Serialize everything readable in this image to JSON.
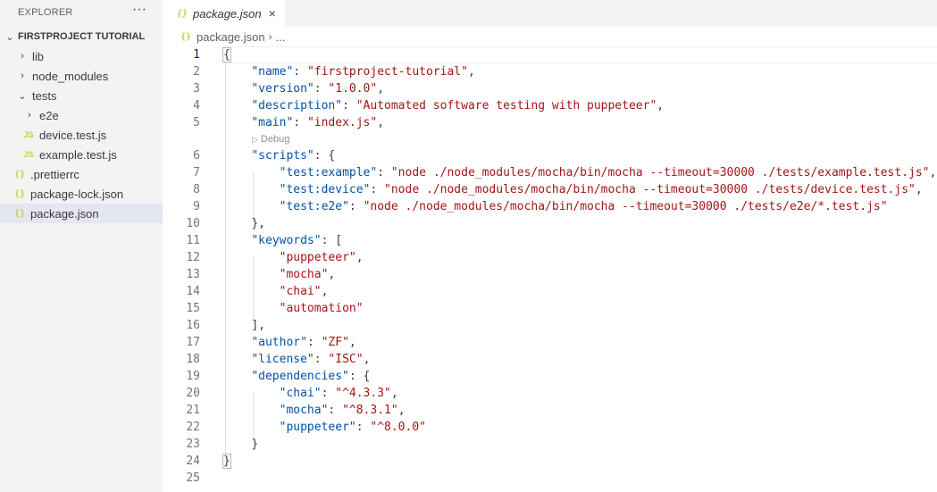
{
  "sidebar": {
    "title": "EXPLORER",
    "more": "···",
    "project": "FIRSTPROJECT TUTORIAL",
    "items": [
      {
        "label": "lib",
        "chev": "›"
      },
      {
        "label": "node_modules",
        "chev": "›"
      },
      {
        "label": "tests",
        "chev": "⌄"
      },
      {
        "label": "e2e",
        "chev": "›"
      },
      {
        "label": "device.test.js",
        "icon": "JS"
      },
      {
        "label": "example.test.js",
        "icon": "JS"
      },
      {
        "label": ".prettierrc",
        "icon": "{}"
      },
      {
        "label": "package-lock.json",
        "icon": "{}"
      },
      {
        "label": "package.json",
        "icon": "{}"
      }
    ]
  },
  "tab": {
    "icon": "{}",
    "label": "package.json",
    "close": "×"
  },
  "breadcrumb": {
    "icon": "{}",
    "file": "package.json",
    "sep": "›",
    "more": "..."
  },
  "codelens": {
    "icon": "▷",
    "label": "Debug"
  },
  "code": {
    "line_numbers": [
      "1",
      "2",
      "3",
      "4",
      "5",
      "6",
      "7",
      "8",
      "9",
      "10",
      "11",
      "12",
      "13",
      "14",
      "15",
      "16",
      "17",
      "18",
      "19",
      "20",
      "21",
      "22",
      "23",
      "24",
      "25"
    ],
    "l1": "{",
    "l2": {
      "key": "\"name\"",
      "val": "\"firstproject-tutorial\"",
      "tail": ","
    },
    "l3": {
      "key": "\"version\"",
      "val": "\"1.0.0\"",
      "tail": ","
    },
    "l4": {
      "key": "\"description\"",
      "val": "\"Automated software testing with puppeteer\"",
      "tail": ","
    },
    "l5": {
      "key": "\"main\"",
      "val": "\"index.js\"",
      "tail": ","
    },
    "l6": {
      "key": "\"scripts\"",
      "tail": ": {"
    },
    "l7": {
      "key": "\"test:example\"",
      "val": "\"node ./node_modules/mocha/bin/mocha --timeout=30000 ./tests/example.test.js\"",
      "tail": ","
    },
    "l8": {
      "key": "\"test:device\"",
      "val": "\"node ./node_modules/mocha/bin/mocha --timeout=30000 ./tests/device.test.js\"",
      "tail": ","
    },
    "l9": {
      "key": "\"test:e2e\"",
      "val": "\"node ./node_modules/mocha/bin/mocha --timeout=30000 ./tests/e2e/*.test.js\""
    },
    "l10": "},",
    "l11": {
      "key": "\"keywords\"",
      "tail": ": ["
    },
    "l12": {
      "val": "\"puppeteer\"",
      "tail": ","
    },
    "l13": {
      "val": "\"mocha\"",
      "tail": ","
    },
    "l14": {
      "val": "\"chai\"",
      "tail": ","
    },
    "l15": {
      "val": "\"automation\""
    },
    "l16": "],",
    "l17": {
      "key": "\"author\"",
      "val": "\"ZF\"",
      "tail": ","
    },
    "l18": {
      "key": "\"license\"",
      "val": "\"ISC\"",
      "tail": ","
    },
    "l19": {
      "key": "\"dependencies\"",
      "tail": ": {"
    },
    "l20": {
      "key": "\"chai\"",
      "val": "\"^4.3.3\"",
      "tail": ","
    },
    "l21": {
      "key": "\"mocha\"",
      "val": "\"^8.3.1\"",
      "tail": ","
    },
    "l22": {
      "key": "\"puppeteer\"",
      "val": "\"^8.0.0\""
    },
    "l23": "}",
    "l24": "}",
    "colon": ": "
  }
}
